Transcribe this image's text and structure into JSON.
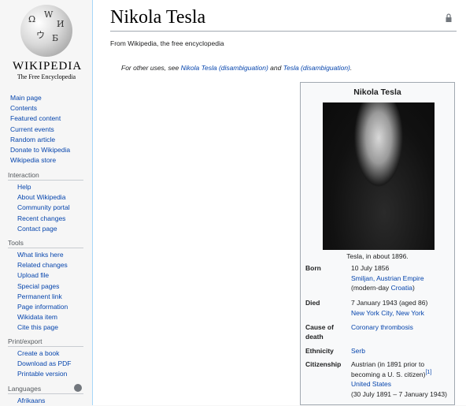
{
  "logo": {
    "wordmark": "WIKIPEDIA",
    "tagline": "The Free Encyclopedia"
  },
  "nav": {
    "main": [
      "Main page",
      "Contents",
      "Featured content",
      "Current events",
      "Random article",
      "Donate to Wikipedia",
      "Wikipedia store"
    ],
    "sections": [
      {
        "heading": "Interaction",
        "items": [
          "Help",
          "About Wikipedia",
          "Community portal",
          "Recent changes",
          "Contact page"
        ]
      },
      {
        "heading": "Tools",
        "items": [
          "What links here",
          "Related changes",
          "Upload file",
          "Special pages",
          "Permanent link",
          "Page information",
          "Wikidata item",
          "Cite this page"
        ]
      },
      {
        "heading": "Print/export",
        "items": [
          "Create a book",
          "Download as PDF",
          "Printable version"
        ]
      },
      {
        "heading": "Languages",
        "items": [
          "Afrikaans"
        ]
      }
    ]
  },
  "article": {
    "title": "Nikola Tesla",
    "site_sub": "From Wikipedia, the free encyclopedia",
    "hatnote": {
      "prefix": "For other uses, see ",
      "link1": "Nikola Tesla (disambiguation)",
      "and": " and ",
      "link2": "Tesla (disambiguation)",
      "suffix": "."
    }
  },
  "infobox": {
    "title": "Nikola Tesla",
    "caption": "Tesla, in about 1896.",
    "born_label": "Born",
    "born_date": "10 July 1856",
    "born_place": "Smiljan, Austrian Empire",
    "born_modern_pre": "(modern-day ",
    "born_modern_link": "Croatia",
    "born_modern_post": ")",
    "died_label": "Died",
    "died_date": "7 January 1943 (aged 86)",
    "died_place": "New York City, New York",
    "cause_label_1": "Cause of",
    "cause_label_2": "death",
    "cause_value": "Coronary thrombosis",
    "ethnicity_label": "Ethnicity",
    "ethnicity_value": "Serb",
    "citizenship_label": "Citizenship",
    "cit_line1": "Austrian (in 1891 prior to",
    "cit_line2": "becoming a U. S. citizen)",
    "cit_ref": "[1]",
    "cit_us": "United States",
    "cit_us_dates": "(30 July 1891 – 7 January 1943)"
  },
  "colors": {
    "link": "#0645ad",
    "sidebar_bg": "#f6f6f6",
    "infobox_bg": "#f8f9fa"
  }
}
